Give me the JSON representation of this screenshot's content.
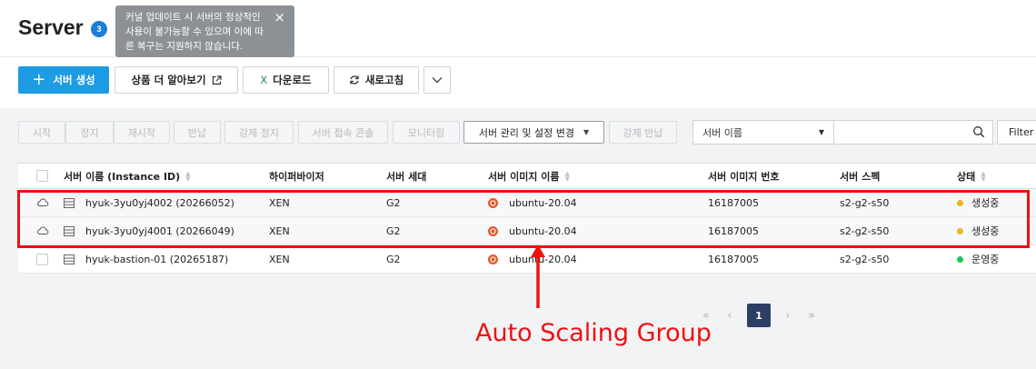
{
  "header": {
    "title": "Server",
    "count": "3",
    "tooltip": {
      "text": "커널 업데이트 시 서버의 정상적인 사용이 불가능할 수 있으며 이에 따른 복구는 지원하지 않습니다.",
      "close": "×"
    }
  },
  "toolbar": {
    "create": "서버 생성",
    "learn_more": "상품 더 알아보기",
    "download": "다운로드",
    "refresh": "새로고침"
  },
  "actions": {
    "start": "시작",
    "stop": "정지",
    "restart": "재시작",
    "return": "반납",
    "force_stop": "강제 정지",
    "console": "서버 접속 콘솔",
    "monitoring": "모니터링",
    "manage": "서버 관리 및 설정 변경",
    "force_return": "강제 반납"
  },
  "search": {
    "field": "서버 이름",
    "filter": "Filter"
  },
  "table": {
    "headers": {
      "name": "서버 이름 (Instance ID)",
      "hypervisor": "하이퍼바이저",
      "generation": "서버 세대",
      "image_name": "서버 이미지 이름",
      "image_number": "서버 이미지 번호",
      "spec": "서버 스펙",
      "status": "상태"
    },
    "rows": [
      {
        "name": "hyuk-3yu0yj4002 (20266052)",
        "hypervisor": "XEN",
        "generation": "G2",
        "image": "ubuntu-20.04",
        "image_no": "16187005",
        "spec": "s2-g2-s50",
        "status": "생성중",
        "status_color": "#e8b81c",
        "auto_scaling": true
      },
      {
        "name": "hyuk-3yu0yj4001 (20266049)",
        "hypervisor": "XEN",
        "generation": "G2",
        "image": "ubuntu-20.04",
        "image_no": "16187005",
        "spec": "s2-g2-s50",
        "status": "생성중",
        "status_color": "#e8b81c",
        "auto_scaling": true
      },
      {
        "name": "hyuk-bastion-01 (20265187)",
        "hypervisor": "XEN",
        "generation": "G2",
        "image": "ubuntu-20.04",
        "image_no": "16187005",
        "spec": "s2-g2-s50",
        "status": "운영중",
        "status_color": "#22c455",
        "auto_scaling": false
      }
    ]
  },
  "pagination": {
    "first": "«",
    "prev": "‹",
    "current": "1",
    "next": "›",
    "last": "»"
  },
  "annotation": {
    "label": "Auto Scaling Group",
    "color": "#ee1111"
  }
}
